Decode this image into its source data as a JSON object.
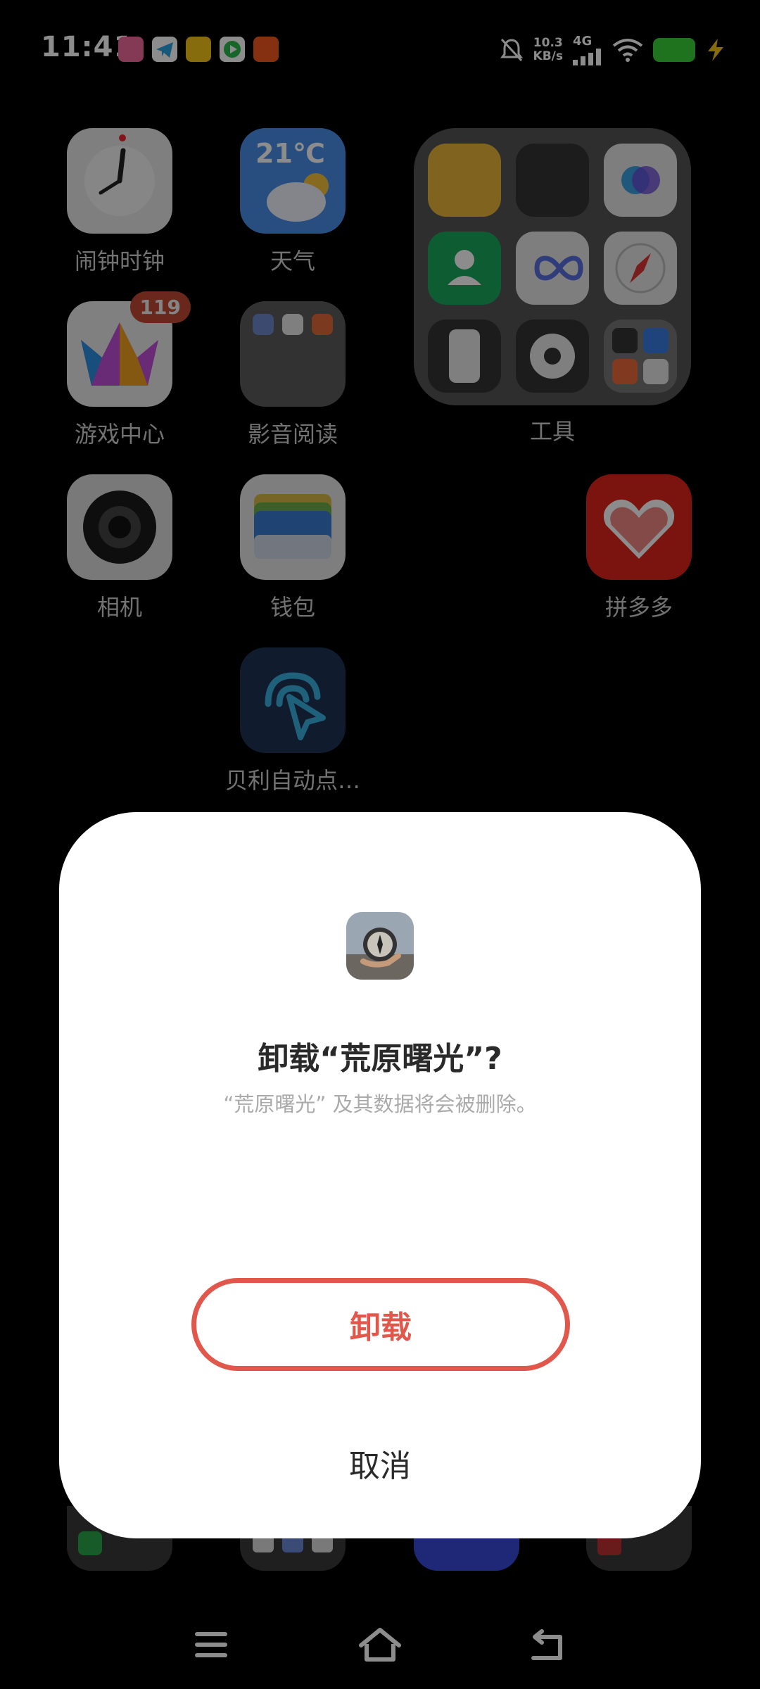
{
  "status_bar": {
    "time": "11:41",
    "net_speed_value": "10.3",
    "net_speed_unit": "KB/s",
    "network_type": "4G",
    "icons": [
      "bilibili-icon",
      "telegram-icon",
      "yellow-app-icon",
      "video-app-icon",
      "dual-app-icon",
      "mute-bell-icon",
      "signal-icon",
      "wifi-icon",
      "battery-icon",
      "charging-icon"
    ]
  },
  "home": {
    "apps": [
      {
        "id": "clock",
        "label": "闹钟时钟",
        "icon": "clock-icon"
      },
      {
        "id": "weather",
        "label": "天气",
        "icon": "weather-icon",
        "temp": "21℃"
      },
      {
        "id": "games",
        "label": "游戏中心",
        "icon": "game-center-icon",
        "badge": "119"
      },
      {
        "id": "media",
        "label": "影音阅读",
        "icon": "media-folder-icon"
      },
      {
        "id": "camera",
        "label": "相机",
        "icon": "camera-icon"
      },
      {
        "id": "wallet",
        "label": "钱包",
        "icon": "wallet-icon"
      },
      {
        "id": "pinduoduo",
        "label": "拼多多",
        "icon": "pinduoduo-icon"
      },
      {
        "id": "autoclick",
        "label": "贝利自动点…",
        "icon": "auto-click-icon"
      }
    ],
    "folder": {
      "label": "工具"
    }
  },
  "dialog": {
    "title": "卸载“荒原曙光”?",
    "subtitle": "“荒原曙光” 及其数据将会被删除。",
    "confirm_label": "卸载",
    "cancel_label": "取消",
    "accent_color": "#e2574c"
  },
  "navbar": {
    "icons": [
      "menu-icon",
      "home-icon",
      "back-icon"
    ]
  }
}
